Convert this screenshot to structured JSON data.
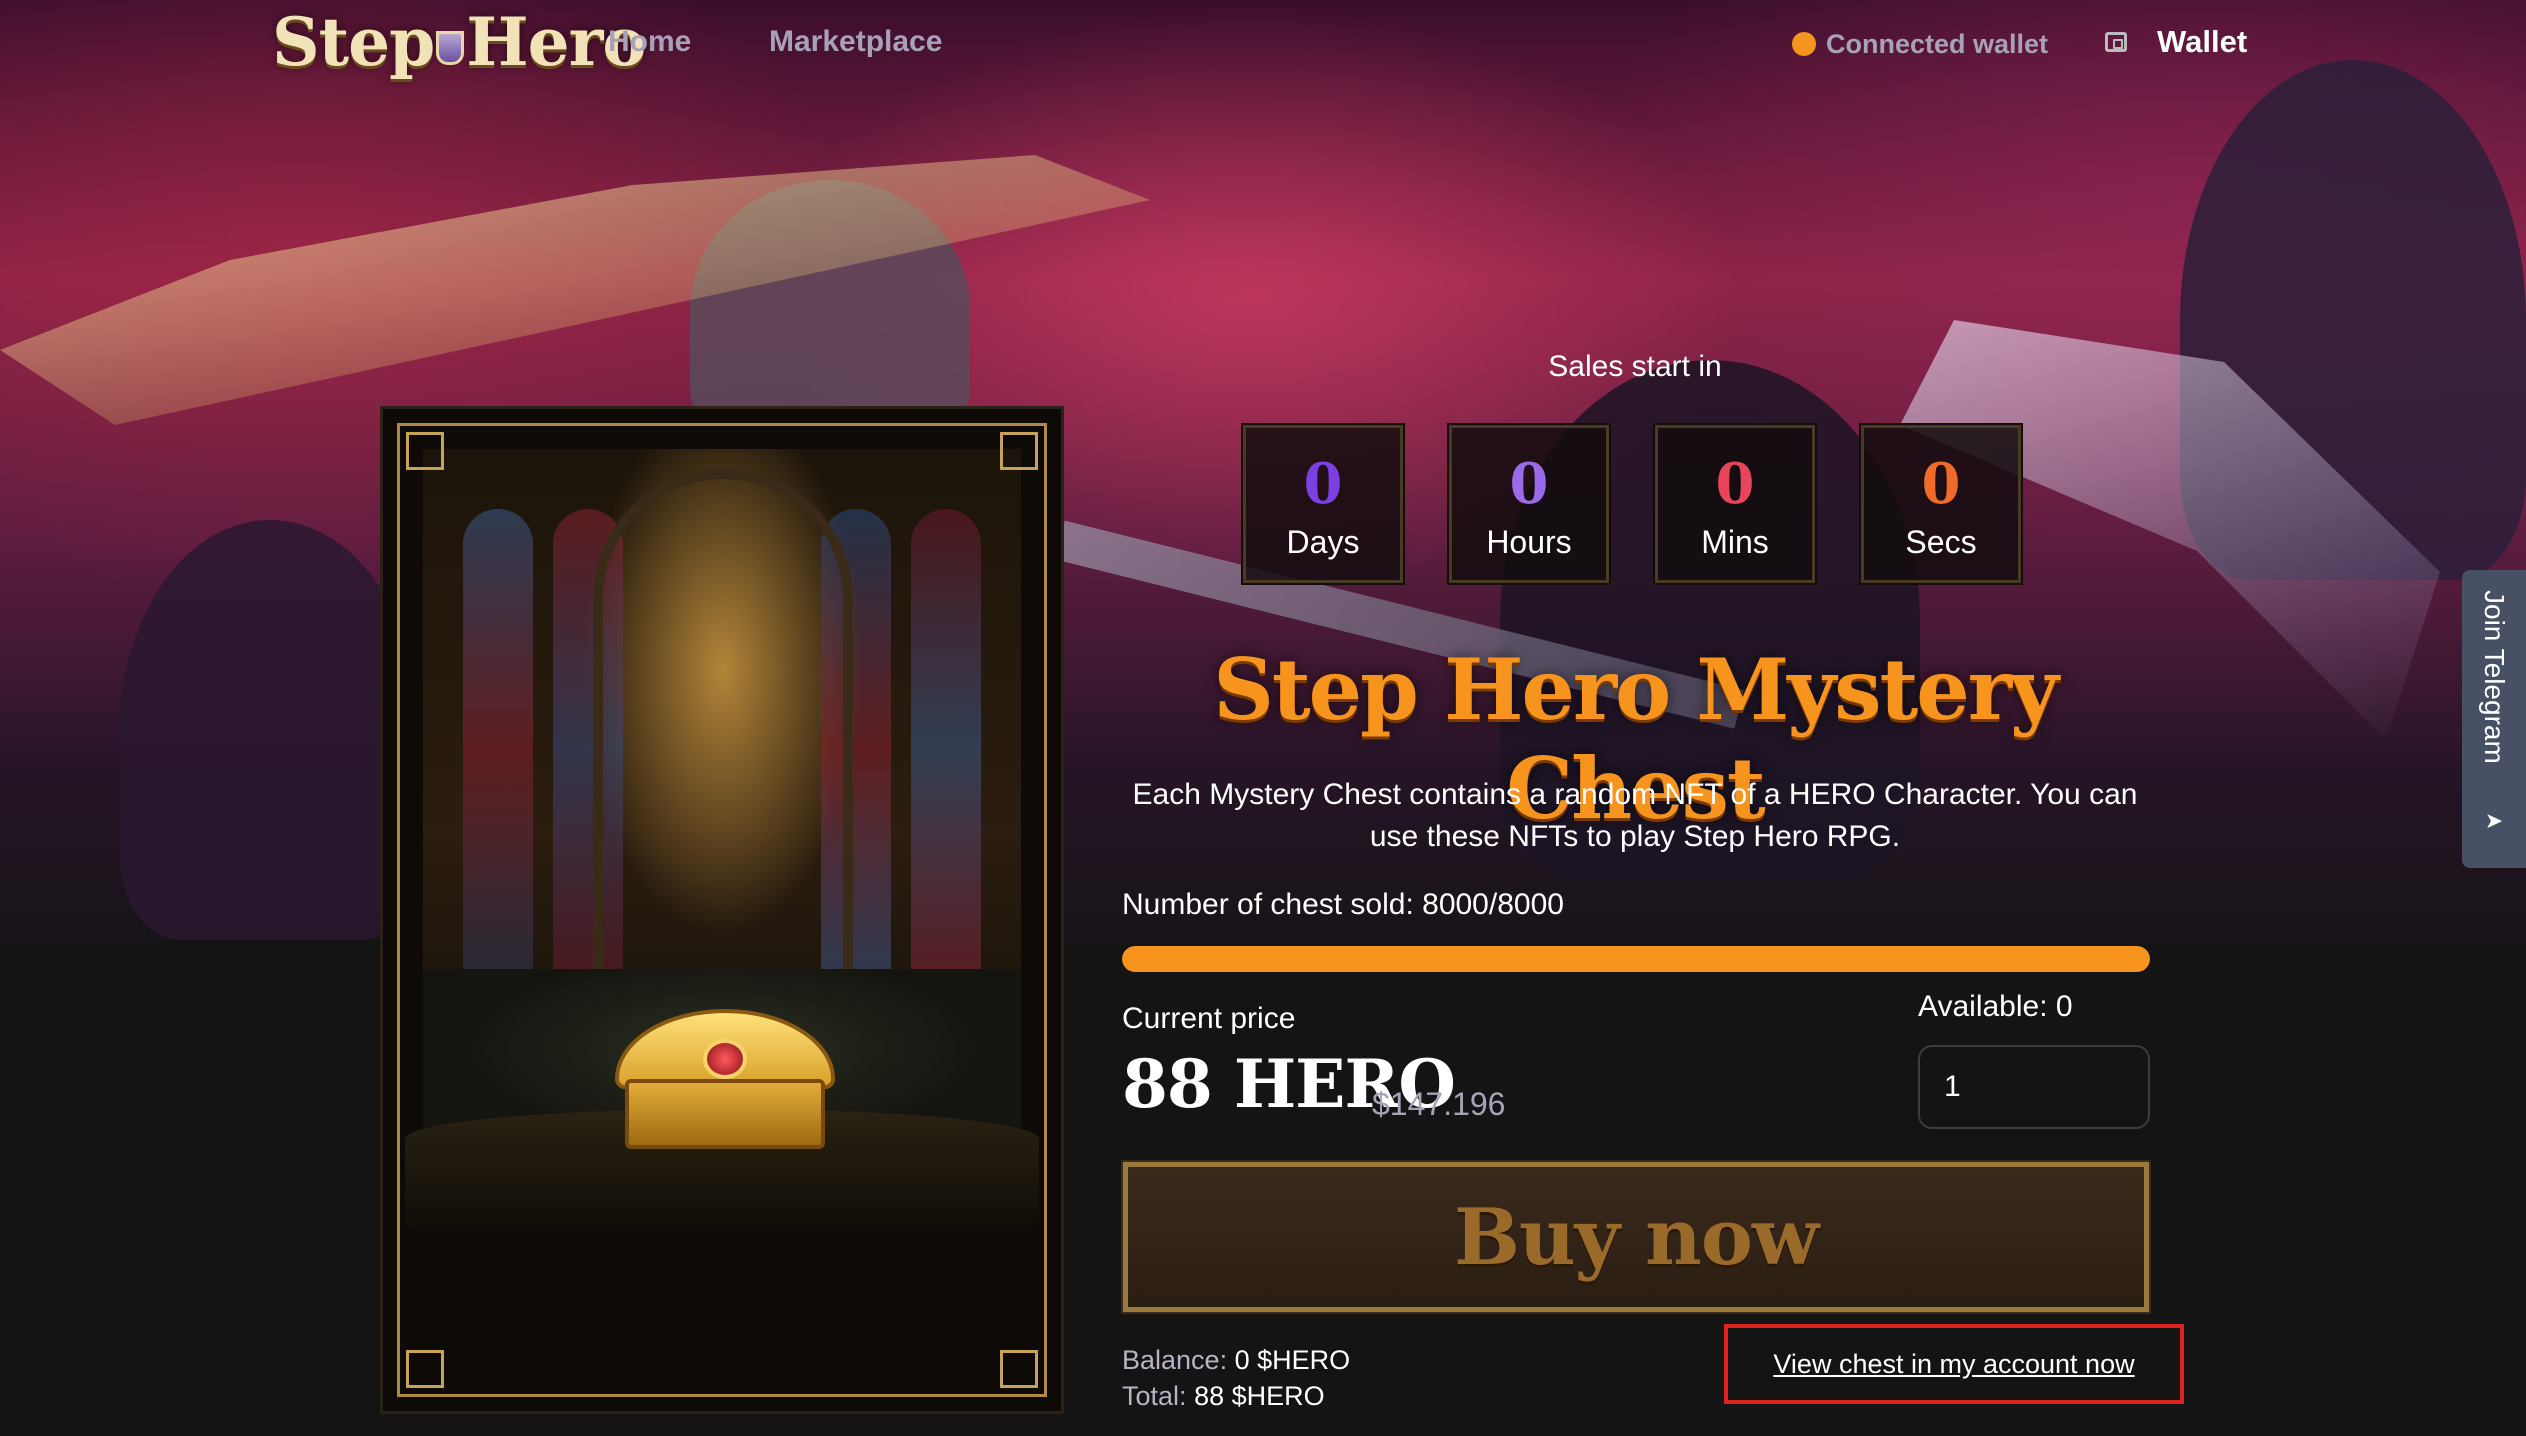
{
  "brand": {
    "logo_text_left": "Step",
    "logo_text_right": "Hero"
  },
  "nav": {
    "home": "Home",
    "marketplace": "Marketplace"
  },
  "wallet": {
    "status_label": "Connected wallet",
    "button_label": "Wallet",
    "status_color": "#f7941d"
  },
  "sale": {
    "sales_start_label": "Sales start in",
    "countdown": [
      {
        "value": "0",
        "label": "Days",
        "color": "#7b3fe4"
      },
      {
        "value": "0",
        "label": "Hours",
        "color": "#9a6ae8"
      },
      {
        "value": "0",
        "label": "Mins",
        "color": "#e8445a"
      },
      {
        "value": "0",
        "label": "Secs",
        "color": "#f06a2a"
      }
    ],
    "title": "Step Hero Mystery Chest",
    "description": "Each Mystery Chest contains a random NFT of a HERO Character. You can use these NFTs to play Step Hero RPG.",
    "sold_label": "Number of chest sold: 8000/8000",
    "sold_fraction": 1.0,
    "price_label": "Current price",
    "price_hero": "88 HERO",
    "price_usd": "$147.196",
    "available_label": "Available: 0",
    "quantity_value": "1",
    "buy_label": "Buy now",
    "balance_key": "Balance:",
    "balance_value": "0 $HERO",
    "total_key": "Total:",
    "total_value": "88 $HERO",
    "view_link": "View chest in my account now"
  },
  "telegram": {
    "label": "Join Telegram",
    "icon": "send-icon"
  },
  "colors": {
    "accent": "#f7941d",
    "highlight_border": "#e0221f",
    "background": "#141414"
  }
}
